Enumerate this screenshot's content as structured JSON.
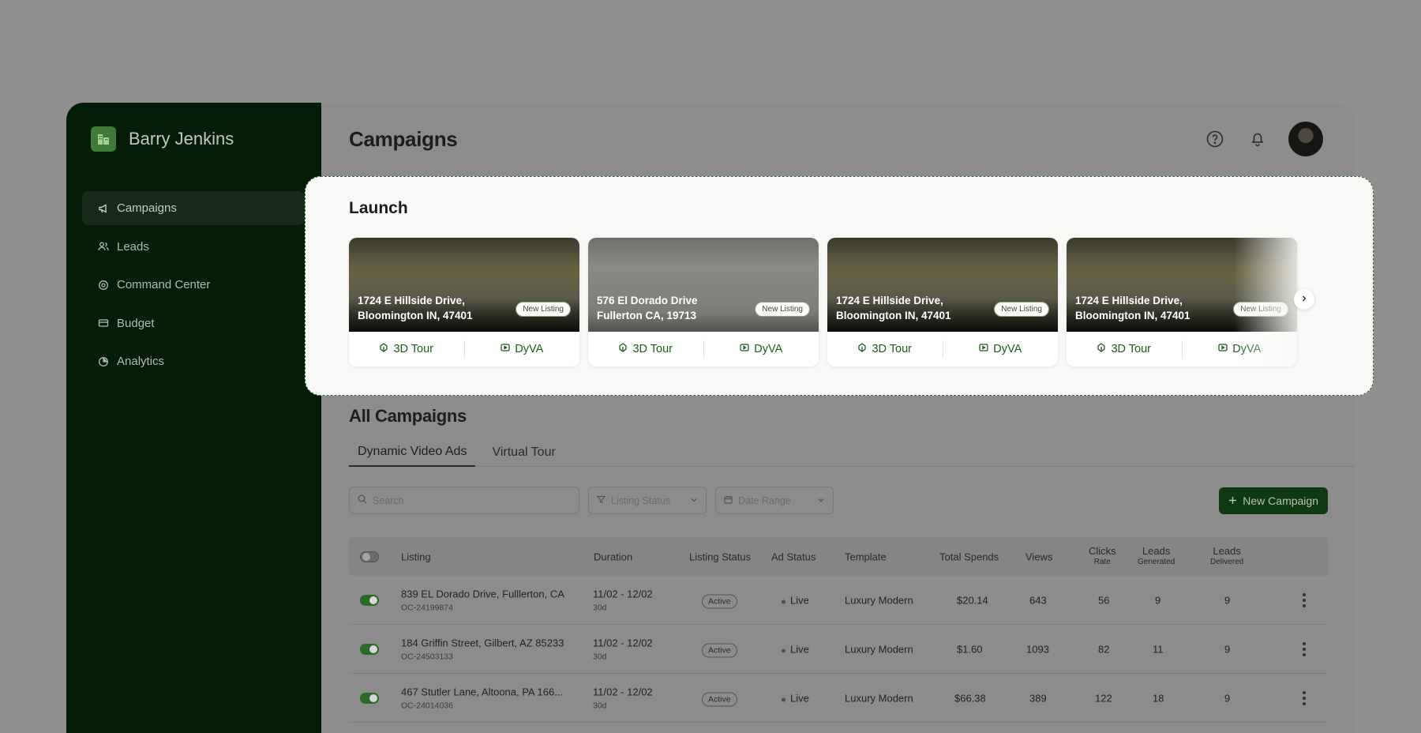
{
  "brand": {
    "name": "Barry Jenkins"
  },
  "sidebar": {
    "items": [
      {
        "label": "Campaigns",
        "icon": "megaphone-icon",
        "active": true
      },
      {
        "label": "Leads",
        "icon": "users-icon"
      },
      {
        "label": "Command Center",
        "icon": "gear-icon"
      },
      {
        "label": "Budget",
        "icon": "card-icon"
      },
      {
        "label": "Analytics",
        "icon": "pie-chart-icon"
      }
    ]
  },
  "header": {
    "title": "Campaigns"
  },
  "launch": {
    "title": "Launch",
    "cards": [
      {
        "address": "1724 E Hillside Drive, Bloomington IN, 47401",
        "badge": "New Listing",
        "tour": "3D Tour",
        "dyva": "DyVA"
      },
      {
        "address": "576 El Dorado Drive Fullerton CA, 19713",
        "badge": "New Listing",
        "tour": "3D Tour",
        "dyva": "DyVA"
      },
      {
        "address": "1724 E Hillside Drive, Bloomington IN, 47401",
        "badge": "New Listing",
        "tour": "3D Tour",
        "dyva": "DyVA"
      },
      {
        "address": "1724 E Hillside Drive, Bloomington IN, 47401",
        "badge": "New Listing",
        "tour": "3D Tour",
        "dyva": "DyVA"
      }
    ]
  },
  "campaigns": {
    "title": "All Campaigns",
    "tabs": [
      "Dynamic Video Ads",
      "Virtual Tour"
    ],
    "search_placeholder": "Search",
    "listing_status_placeholder": "Listing Status",
    "date_range_placeholder": "Date Range",
    "new_button": "New Campaign",
    "columns": {
      "listing": "Listing",
      "duration": "Duration",
      "listing_status": "Listing Status",
      "ad_status": "Ad Status",
      "template": "Template",
      "total_spends": "Total Spends",
      "views": "Views",
      "clicks": "Clicks",
      "clicks_sub": "Rate",
      "leads_gen": "Leads",
      "leads_gen_sub": "Generated",
      "leads_del": "Leads",
      "leads_del_sub": "Delivered"
    },
    "rows": [
      {
        "address": "839 EL Dorado Drive, Fulllerton, CA",
        "id": "OC-24199874",
        "duration": "11/02 - 12/02",
        "days": "30d",
        "listing_status": "Active",
        "ad_status": "Live",
        "template": "Luxury Modern",
        "spend": "$20.14",
        "views": "643",
        "clicks": "56",
        "leads_generated": "9",
        "leads_delivered": "9"
      },
      {
        "address": "184 Griffin Street, Gilbert, AZ 85233",
        "id": "OC-24503133",
        "duration": "11/02 - 12/02",
        "days": "30d",
        "listing_status": "Active",
        "ad_status": "Live",
        "template": "Luxury Modern",
        "spend": "$1.60",
        "views": "1093",
        "clicks": "82",
        "leads_generated": "11",
        "leads_delivered": "9"
      },
      {
        "address": "467 Stutler Lane, Altoona, PA 166...",
        "id": "OC-24014036",
        "duration": "11/02 - 12/02",
        "days": "30d",
        "listing_status": "Active",
        "ad_status": "Live",
        "template": "Luxury Modern",
        "spend": "$66.38",
        "views": "389",
        "clicks": "122",
        "leads_generated": "18",
        "leads_delivered": "9"
      }
    ]
  }
}
